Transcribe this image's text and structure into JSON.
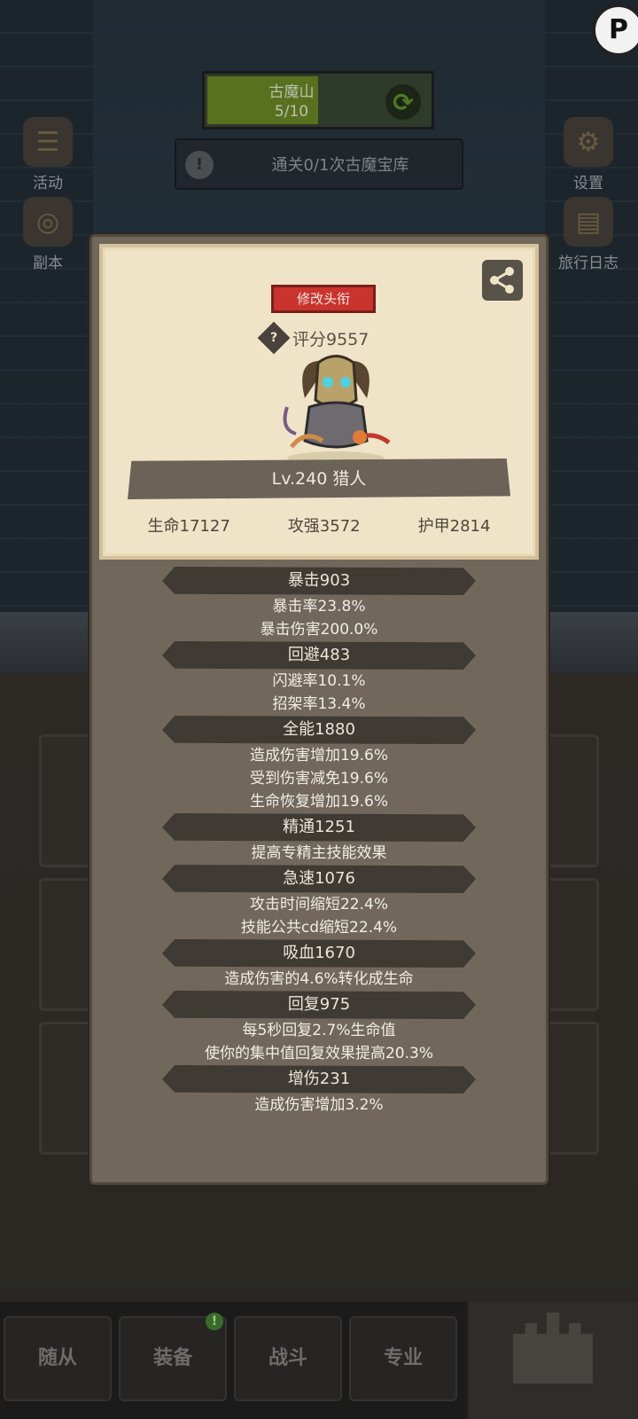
{
  "background": {
    "stage": {
      "name": "古魔山",
      "progress": "5/10",
      "progress_fraction": 0.5
    },
    "quest": {
      "text": "通关0/1次古魔宝库"
    },
    "left_buttons": [
      {
        "label": "活动"
      },
      {
        "label": "副本"
      }
    ],
    "right_buttons": [
      {
        "label": "设置"
      },
      {
        "label": "旅行日志"
      }
    ],
    "tabs": [
      {
        "label": "随从"
      },
      {
        "label": "装备",
        "badge": "!"
      },
      {
        "label": "战斗"
      },
      {
        "label": "专业"
      },
      {
        "label": "主城"
      }
    ]
  },
  "profile": {
    "title_button": "修改头衔",
    "score": "评分9557",
    "level_class": "Lv.240 猎人",
    "stats": [
      {
        "text": "生命17127"
      },
      {
        "text": "攻强3572"
      },
      {
        "text": "护甲2814"
      }
    ],
    "groups": [
      {
        "header": "暴击903",
        "lines": [
          "暴击率23.8%",
          "暴击伤害200.0%"
        ]
      },
      {
        "header": "回避483",
        "lines": [
          "闪避率10.1%",
          "招架率13.4%"
        ]
      },
      {
        "header": "全能1880",
        "lines": [
          "造成伤害增加19.6%",
          "受到伤害减免19.6%",
          "生命恢复增加19.6%"
        ]
      },
      {
        "header": "精通1251",
        "lines": [
          "提高专精主技能效果"
        ]
      },
      {
        "header": "急速1076",
        "lines": [
          "攻击时间缩短22.4%",
          "技能公共cd缩短22.4%"
        ]
      },
      {
        "header": "吸血1670",
        "lines": [
          "造成伤害的4.6%转化成生命"
        ]
      },
      {
        "header": "回复975",
        "lines": [
          "每5秒回复2.7%生命值",
          "使你的集中值回复效果提高20.3%"
        ]
      },
      {
        "header": "增伤231",
        "lines": [
          "造成伤害增加3.2%"
        ]
      }
    ]
  },
  "colors": {
    "title_button": "#c8332e",
    "card_bg": "#efe4c8",
    "modal_bg": "#71685b",
    "progress_fill": "#59701f"
  }
}
